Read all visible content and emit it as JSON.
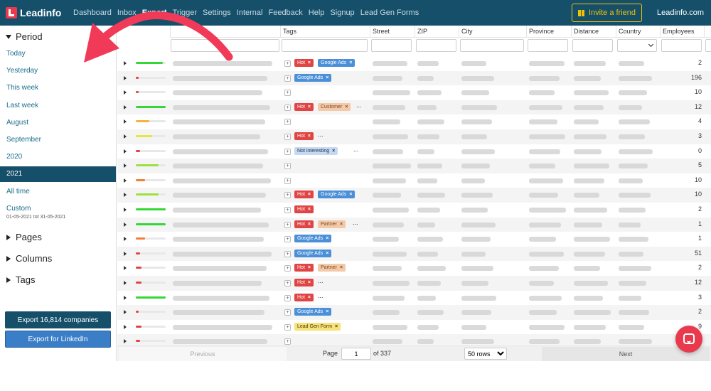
{
  "nav": {
    "brand": "Leadinfo",
    "links": [
      "Dashboard",
      "Inbox",
      "Export",
      "Trigger",
      "Settings",
      "Internal",
      "Feedback",
      "Help",
      "Signup",
      "Lead Gen Forms"
    ],
    "active": "Export",
    "invite_label": "Invite a friend",
    "site_link": "Leadinfo.com"
  },
  "sidebar": {
    "period_title": "Period",
    "period_items": [
      "Today",
      "Yesterday",
      "This week",
      "Last week",
      "August",
      "September",
      "2020",
      "2021",
      "All time",
      "Custom"
    ],
    "active_period": "2021",
    "custom_range": "01-05-2021 tot 31-05-2021",
    "collapsed_sections": [
      "Pages",
      "Columns",
      "Tags"
    ],
    "export_button": "Export 16,814 companies",
    "linkedin_button": "Export for LinkedIn"
  },
  "table": {
    "headers": [
      "Tags",
      "Street",
      "ZIP",
      "City",
      "Province",
      "Distance",
      "Country",
      "Employees"
    ],
    "rows": [
      {
        "score": 0.9,
        "color": "#36d636",
        "tags": [
          {
            "t": "Hot",
            "k": "hot"
          },
          {
            "t": "Google Ads",
            "k": "gads"
          }
        ],
        "more": false,
        "emp": "2"
      },
      {
        "score": 0.1,
        "color": "#e04444",
        "tags": [
          {
            "t": "Google Ads",
            "k": "gads"
          }
        ],
        "more": false,
        "emp": "196"
      },
      {
        "score": 0.1,
        "color": "#e04444",
        "tags": [],
        "more": false,
        "emp": "10"
      },
      {
        "score": 1.0,
        "color": "#36d636",
        "tags": [
          {
            "t": "Hot",
            "k": "hot"
          },
          {
            "t": "Customer",
            "k": "cust"
          }
        ],
        "more": true,
        "emp": "12"
      },
      {
        "score": 0.45,
        "color": "#f2b640",
        "tags": [],
        "more": false,
        "emp": "4"
      },
      {
        "score": 0.55,
        "color": "#e6e640",
        "tags": [
          {
            "t": "Hot",
            "k": "hot"
          }
        ],
        "more": true,
        "emp": "3"
      },
      {
        "score": 0.15,
        "color": "#e04444",
        "tags": [
          {
            "t": "Not interesting",
            "k": "ni"
          }
        ],
        "more": true,
        "emp": "0"
      },
      {
        "score": 0.75,
        "color": "#9de040",
        "tags": [],
        "more": false,
        "emp": "5"
      },
      {
        "score": 0.3,
        "color": "#f2803a",
        "tags": [],
        "more": false,
        "emp": "10"
      },
      {
        "score": 0.75,
        "color": "#9de040",
        "tags": [
          {
            "t": "Hot",
            "k": "hot"
          },
          {
            "t": "Google Ads",
            "k": "gads"
          }
        ],
        "more": false,
        "emp": "10"
      },
      {
        "score": 1.0,
        "color": "#36d636",
        "tags": [
          {
            "t": "Hot",
            "k": "hot"
          }
        ],
        "more": false,
        "emp": "2"
      },
      {
        "score": 1.0,
        "color": "#36d636",
        "tags": [
          {
            "t": "Hot",
            "k": "hot"
          },
          {
            "t": "Partner",
            "k": "partner"
          }
        ],
        "more": true,
        "emp": "1"
      },
      {
        "score": 0.3,
        "color": "#f2803a",
        "tags": [
          {
            "t": "Google Ads",
            "k": "gads"
          }
        ],
        "more": false,
        "emp": "1"
      },
      {
        "score": 0.15,
        "color": "#e04444",
        "tags": [
          {
            "t": "Google Ads",
            "k": "gads"
          }
        ],
        "more": false,
        "emp": "51"
      },
      {
        "score": 0.2,
        "color": "#e04444",
        "tags": [
          {
            "t": "Hot",
            "k": "hot"
          },
          {
            "t": "Partner",
            "k": "partner"
          }
        ],
        "more": false,
        "emp": "2"
      },
      {
        "score": 0.2,
        "color": "#e04444",
        "tags": [
          {
            "t": "Hot",
            "k": "hot"
          }
        ],
        "more": true,
        "emp": "12"
      },
      {
        "score": 1.0,
        "color": "#36d636",
        "tags": [
          {
            "t": "Hot",
            "k": "hot"
          }
        ],
        "more": true,
        "emp": "3"
      },
      {
        "score": 0.1,
        "color": "#e04444",
        "tags": [
          {
            "t": "Google Ads",
            "k": "gads"
          }
        ],
        "more": false,
        "emp": "2"
      },
      {
        "score": 0.2,
        "color": "#e04444",
        "tags": [
          {
            "t": "Lead Gen Form",
            "k": "lgf"
          }
        ],
        "more": false,
        "emp": "9"
      },
      {
        "score": 0.15,
        "color": "#e04444",
        "tags": [],
        "more": false,
        "emp": ""
      }
    ]
  },
  "pager": {
    "previous": "Previous",
    "next": "Next",
    "page_label": "Page",
    "page_value": "1",
    "of_label": "of 337",
    "rows_option": "50 rows"
  }
}
